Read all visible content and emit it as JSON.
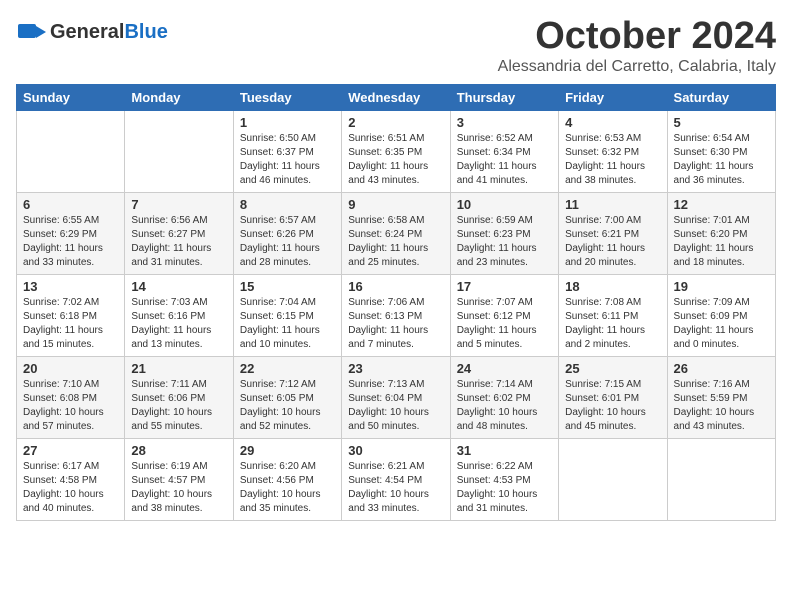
{
  "header": {
    "logo_line1": "General",
    "logo_line2": "Blue",
    "month": "October 2024",
    "location": "Alessandria del Carretto, Calabria, Italy"
  },
  "weekdays": [
    "Sunday",
    "Monday",
    "Tuesday",
    "Wednesday",
    "Thursday",
    "Friday",
    "Saturday"
  ],
  "weeks": [
    [
      {
        "day": "",
        "info": ""
      },
      {
        "day": "",
        "info": ""
      },
      {
        "day": "1",
        "info": "Sunrise: 6:50 AM\nSunset: 6:37 PM\nDaylight: 11 hours\nand 46 minutes."
      },
      {
        "day": "2",
        "info": "Sunrise: 6:51 AM\nSunset: 6:35 PM\nDaylight: 11 hours\nand 43 minutes."
      },
      {
        "day": "3",
        "info": "Sunrise: 6:52 AM\nSunset: 6:34 PM\nDaylight: 11 hours\nand 41 minutes."
      },
      {
        "day": "4",
        "info": "Sunrise: 6:53 AM\nSunset: 6:32 PM\nDaylight: 11 hours\nand 38 minutes."
      },
      {
        "day": "5",
        "info": "Sunrise: 6:54 AM\nSunset: 6:30 PM\nDaylight: 11 hours\nand 36 minutes."
      }
    ],
    [
      {
        "day": "6",
        "info": "Sunrise: 6:55 AM\nSunset: 6:29 PM\nDaylight: 11 hours\nand 33 minutes."
      },
      {
        "day": "7",
        "info": "Sunrise: 6:56 AM\nSunset: 6:27 PM\nDaylight: 11 hours\nand 31 minutes."
      },
      {
        "day": "8",
        "info": "Sunrise: 6:57 AM\nSunset: 6:26 PM\nDaylight: 11 hours\nand 28 minutes."
      },
      {
        "day": "9",
        "info": "Sunrise: 6:58 AM\nSunset: 6:24 PM\nDaylight: 11 hours\nand 25 minutes."
      },
      {
        "day": "10",
        "info": "Sunrise: 6:59 AM\nSunset: 6:23 PM\nDaylight: 11 hours\nand 23 minutes."
      },
      {
        "day": "11",
        "info": "Sunrise: 7:00 AM\nSunset: 6:21 PM\nDaylight: 11 hours\nand 20 minutes."
      },
      {
        "day": "12",
        "info": "Sunrise: 7:01 AM\nSunset: 6:20 PM\nDaylight: 11 hours\nand 18 minutes."
      }
    ],
    [
      {
        "day": "13",
        "info": "Sunrise: 7:02 AM\nSunset: 6:18 PM\nDaylight: 11 hours\nand 15 minutes."
      },
      {
        "day": "14",
        "info": "Sunrise: 7:03 AM\nSunset: 6:16 PM\nDaylight: 11 hours\nand 13 minutes."
      },
      {
        "day": "15",
        "info": "Sunrise: 7:04 AM\nSunset: 6:15 PM\nDaylight: 11 hours\nand 10 minutes."
      },
      {
        "day": "16",
        "info": "Sunrise: 7:06 AM\nSunset: 6:13 PM\nDaylight: 11 hours\nand 7 minutes."
      },
      {
        "day": "17",
        "info": "Sunrise: 7:07 AM\nSunset: 6:12 PM\nDaylight: 11 hours\nand 5 minutes."
      },
      {
        "day": "18",
        "info": "Sunrise: 7:08 AM\nSunset: 6:11 PM\nDaylight: 11 hours\nand 2 minutes."
      },
      {
        "day": "19",
        "info": "Sunrise: 7:09 AM\nSunset: 6:09 PM\nDaylight: 11 hours\nand 0 minutes."
      }
    ],
    [
      {
        "day": "20",
        "info": "Sunrise: 7:10 AM\nSunset: 6:08 PM\nDaylight: 10 hours\nand 57 minutes."
      },
      {
        "day": "21",
        "info": "Sunrise: 7:11 AM\nSunset: 6:06 PM\nDaylight: 10 hours\nand 55 minutes."
      },
      {
        "day": "22",
        "info": "Sunrise: 7:12 AM\nSunset: 6:05 PM\nDaylight: 10 hours\nand 52 minutes."
      },
      {
        "day": "23",
        "info": "Sunrise: 7:13 AM\nSunset: 6:04 PM\nDaylight: 10 hours\nand 50 minutes."
      },
      {
        "day": "24",
        "info": "Sunrise: 7:14 AM\nSunset: 6:02 PM\nDaylight: 10 hours\nand 48 minutes."
      },
      {
        "day": "25",
        "info": "Sunrise: 7:15 AM\nSunset: 6:01 PM\nDaylight: 10 hours\nand 45 minutes."
      },
      {
        "day": "26",
        "info": "Sunrise: 7:16 AM\nSunset: 5:59 PM\nDaylight: 10 hours\nand 43 minutes."
      }
    ],
    [
      {
        "day": "27",
        "info": "Sunrise: 6:17 AM\nSunset: 4:58 PM\nDaylight: 10 hours\nand 40 minutes."
      },
      {
        "day": "28",
        "info": "Sunrise: 6:19 AM\nSunset: 4:57 PM\nDaylight: 10 hours\nand 38 minutes."
      },
      {
        "day": "29",
        "info": "Sunrise: 6:20 AM\nSunset: 4:56 PM\nDaylight: 10 hours\nand 35 minutes."
      },
      {
        "day": "30",
        "info": "Sunrise: 6:21 AM\nSunset: 4:54 PM\nDaylight: 10 hours\nand 33 minutes."
      },
      {
        "day": "31",
        "info": "Sunrise: 6:22 AM\nSunset: 4:53 PM\nDaylight: 10 hours\nand 31 minutes."
      },
      {
        "day": "",
        "info": ""
      },
      {
        "day": "",
        "info": ""
      }
    ]
  ]
}
